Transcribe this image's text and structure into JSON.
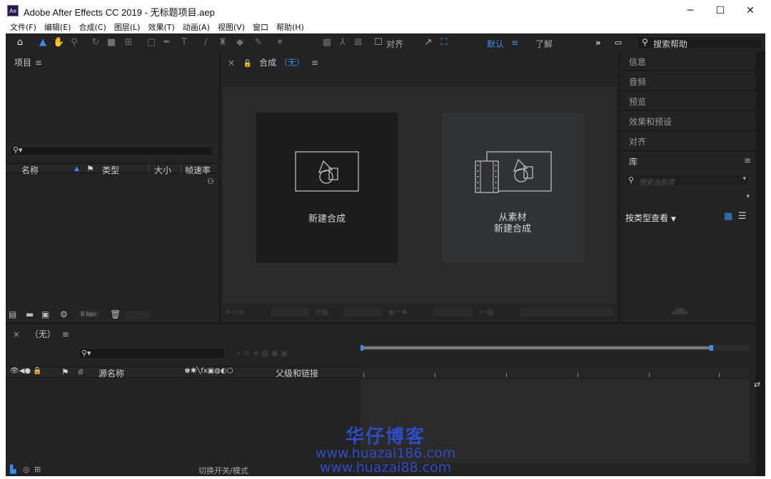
{
  "window": {
    "app_icon": "Ae",
    "title": "Adobe After Effects CC 2019 - 无标题项目.aep",
    "minimize": "─",
    "maximize": "☐",
    "close": "✕"
  },
  "menu": [
    "文件(F)",
    "编辑(E)",
    "合成(C)",
    "图层(L)",
    "效果(T)",
    "动画(A)",
    "视图(V)",
    "窗口",
    "帮助(H)"
  ],
  "toolbar": {
    "align_label": "对齐",
    "workspace_default": "默认",
    "workspace_menu": "≡",
    "workspace_learn": "了解",
    "more": "»",
    "help_placeholder": "搜索帮助"
  },
  "project": {
    "title": "项目",
    "menu": "≡",
    "columns": [
      "名称",
      "类型",
      "大小",
      "帧速率"
    ],
    "bpc": "8 bpc"
  },
  "composition": {
    "close": "×",
    "lock": "🔓",
    "title": "合成",
    "name": "（无）",
    "menu": "≡",
    "new_comp_label": "新建合成",
    "from_footage_line1": "从素材",
    "from_footage_line2": "新建合成"
  },
  "right_panel": {
    "items": [
      "信息",
      "音频",
      "预览",
      "效果和预设",
      "对齐"
    ],
    "library": {
      "title": "库",
      "menu": "≡",
      "search_placeholder": "搜索当前库",
      "sort_label": "按类型查看"
    }
  },
  "timeline": {
    "close": "×",
    "title": "（无）",
    "menu": "≡",
    "source_name": "源名称",
    "parent_link": "父级和链接",
    "switch_modes": "切换开关/模式"
  },
  "watermark": {
    "brand": "华仔博客",
    "url1": "www.huazai186.com",
    "url2": "www.huazai88.com"
  }
}
